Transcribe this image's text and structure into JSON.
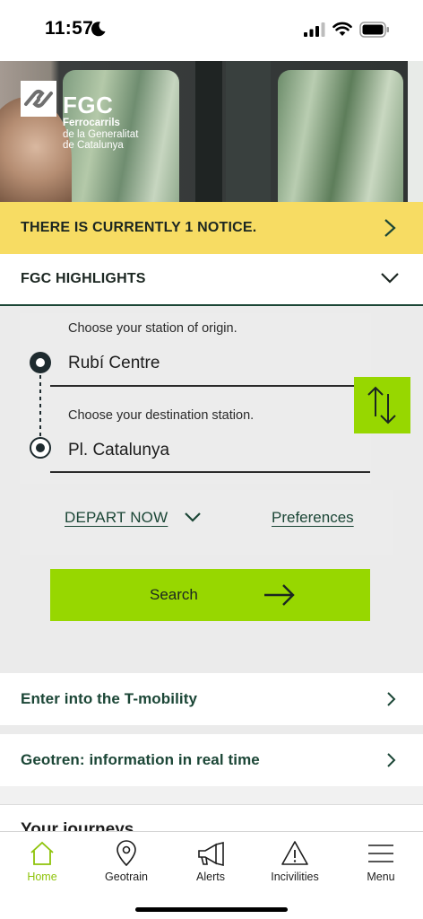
{
  "status_bar": {
    "time": "11:57"
  },
  "hero": {
    "logo_name": "FGC",
    "logo_line1": "Ferrocarrils",
    "logo_line2": "de la Generalitat",
    "logo_line3": "de Catalunya"
  },
  "notice": {
    "text": "THERE IS CURRENTLY 1 NOTICE."
  },
  "highlights": {
    "title": "FGC HIGHLIGHTS"
  },
  "planner": {
    "origin_label": "Choose your station of origin.",
    "origin_value": "Rubí Centre",
    "destination_label": "Choose your destination station.",
    "destination_value": "Pl. Catalunya",
    "depart_label": "DEPART NOW",
    "preferences_label": "Preferences",
    "search_label": "Search"
  },
  "links": {
    "tmobility": "Enter into the T-mobility",
    "geotren": "Geotren: information in real time"
  },
  "journeys": {
    "title": "Your journeys"
  },
  "tabs": [
    {
      "label": "Home",
      "icon": "home-icon",
      "active": true
    },
    {
      "label": "Geotrain",
      "icon": "location-pin-icon",
      "active": false
    },
    {
      "label": "Alerts",
      "icon": "megaphone-icon",
      "active": false
    },
    {
      "label": "Incivilities",
      "icon": "warning-icon",
      "active": false
    },
    {
      "label": "Menu",
      "icon": "hamburger-icon",
      "active": false
    }
  ],
  "colors": {
    "accent_green": "#97d700",
    "notice_yellow": "#f7dc63",
    "dark_green": "#1b4636",
    "active_tab": "#8ec30a"
  }
}
